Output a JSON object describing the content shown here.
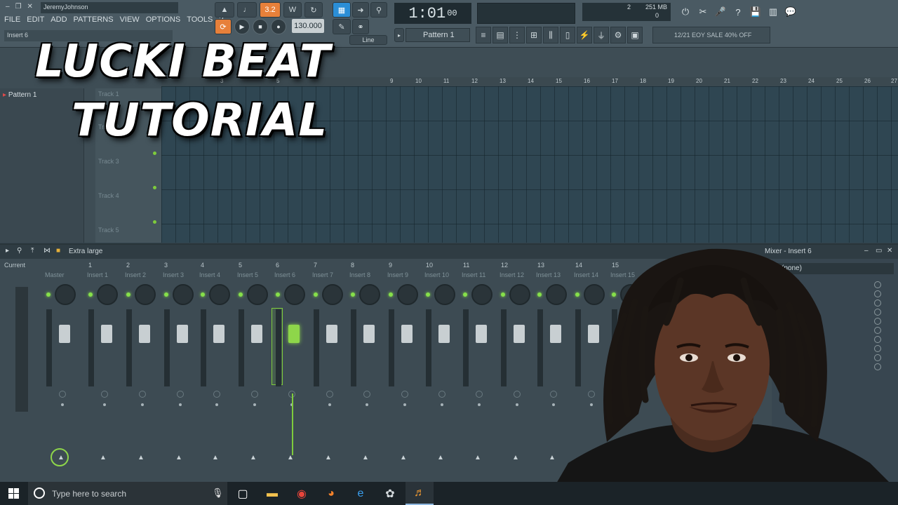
{
  "overlay": {
    "line1": "LUCKI BEAT",
    "line2": "TUTORIAL"
  },
  "toolbar": {
    "user": "JeremyJohnson",
    "menu": [
      "FILE",
      "EDIT",
      "ADD",
      "PATTERNS",
      "VIEW",
      "OPTIONS",
      "TOOLS",
      "?"
    ],
    "insert_label": "Insert 6",
    "tempo": "130.000",
    "time_main": "1:01",
    "time_sub": "00",
    "step_value": "3.2",
    "cpu_value": "2",
    "memory": "251 MB",
    "polyphony": "0",
    "pattern": "Pattern 1",
    "snap": "Line",
    "news": "12/21  EOY SALE 40% OFF"
  },
  "playlist": {
    "pattern_item": "Pattern 1",
    "tracks": [
      "Track 1",
      "Track 2",
      "Track 3",
      "Track 4",
      "Track 5"
    ],
    "ruler": [
      "3",
      "5",
      "9",
      "10",
      "11",
      "12",
      "13",
      "14",
      "15",
      "16",
      "17",
      "18",
      "19",
      "20",
      "21",
      "22",
      "23",
      "24",
      "25",
      "26",
      "27"
    ]
  },
  "mixer": {
    "view_label": "Extra large",
    "title": "Mixer - Insert 6",
    "slot": "(none)",
    "current_label": "Current",
    "strips": [
      {
        "num": "",
        "name": "Master"
      },
      {
        "num": "1",
        "name": "Insert 1"
      },
      {
        "num": "2",
        "name": "Insert 2"
      },
      {
        "num": "3",
        "name": "Insert 3"
      },
      {
        "num": "4",
        "name": "Insert 4"
      },
      {
        "num": "5",
        "name": "Insert 5"
      },
      {
        "num": "6",
        "name": "Insert 6"
      },
      {
        "num": "7",
        "name": "Insert 7"
      },
      {
        "num": "8",
        "name": "Insert 8"
      },
      {
        "num": "9",
        "name": "Insert 9"
      },
      {
        "num": "10",
        "name": "Insert 10"
      },
      {
        "num": "11",
        "name": "Insert 11"
      },
      {
        "num": "12",
        "name": "Insert 12"
      },
      {
        "num": "13",
        "name": "Insert 13"
      },
      {
        "num": "14",
        "name": "Insert 14"
      },
      {
        "num": "15",
        "name": "Insert 15"
      }
    ],
    "selected_index": 6,
    "accent": "#7ecb3c"
  },
  "taskbar": {
    "search_placeholder": "Type here to search",
    "apps": [
      "task-view-icon",
      "file-explorer-icon",
      "chrome-icon",
      "firefox-icon",
      "edge-icon",
      "paint-icon",
      "fl-studio-icon"
    ]
  }
}
